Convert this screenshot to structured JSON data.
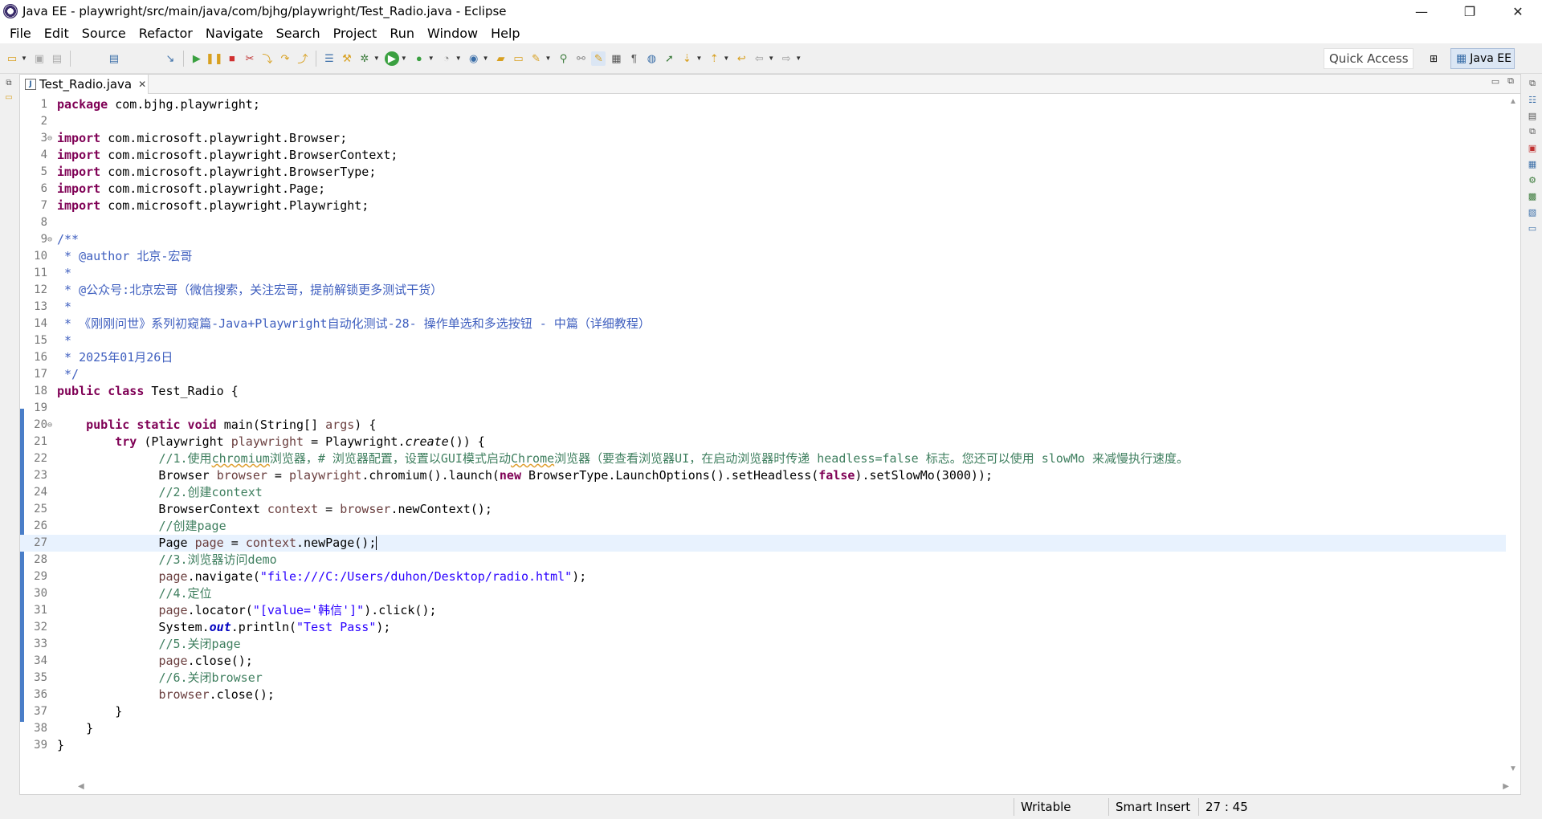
{
  "window": {
    "title": "Java EE - playwright/src/main/java/com/bjhg/playwright/Test_Radio.java - Eclipse",
    "minimize": "—",
    "restore": "❐",
    "close": "✕"
  },
  "menu": [
    "File",
    "Edit",
    "Source",
    "Refactor",
    "Navigate",
    "Search",
    "Project",
    "Run",
    "Window",
    "Help"
  ],
  "toolbar": {
    "quick_access": "Quick Access",
    "perspective": "Java EE"
  },
  "editor": {
    "tab_label": "Test_Radio.java",
    "tab_close": "✕",
    "lines": [
      {
        "n": "1",
        "html": "<span class=\"kw\">package</span> com.bjhg.playwright;"
      },
      {
        "n": "2",
        "html": ""
      },
      {
        "n": "3",
        "fold": "⊖",
        "html": "<span class=\"kw\">import</span> com.microsoft.playwright.Browser;"
      },
      {
        "n": "4",
        "html": "<span class=\"kw\">import</span> com.microsoft.playwright.BrowserContext;"
      },
      {
        "n": "5",
        "html": "<span class=\"kw\">import</span> com.microsoft.playwright.BrowserType;"
      },
      {
        "n": "6",
        "html": "<span class=\"kw\">import</span> com.microsoft.playwright.Page;"
      },
      {
        "n": "7",
        "html": "<span class=\"kw\">import</span> com.microsoft.playwright.Playwright;"
      },
      {
        "n": "8",
        "html": ""
      },
      {
        "n": "9",
        "fold": "⊖",
        "html": "<span class=\"jd\">/**</span>"
      },
      {
        "n": "10",
        "html": "<span class=\"jd\"> * @author 北京-宏哥</span>"
      },
      {
        "n": "11",
        "html": "<span class=\"jd\"> *</span>"
      },
      {
        "n": "12",
        "html": "<span class=\"jd\"> * @公众号:北京宏哥（微信搜索，关注宏哥，提前解锁更多测试干货）</span>"
      },
      {
        "n": "13",
        "html": "<span class=\"jd\"> *</span>"
      },
      {
        "n": "14",
        "html": "<span class=\"jd\"> * 《刚刚问世》系列初窥篇-Java+Playwright自动化测试-28- 操作单选和多选按钮 - 中篇（详细教程）</span>"
      },
      {
        "n": "15",
        "html": "<span class=\"jd\"> *</span>"
      },
      {
        "n": "16",
        "html": "<span class=\"jd\"> * 2025年01月26日</span>"
      },
      {
        "n": "17",
        "html": "<span class=\"jd\"> */</span>"
      },
      {
        "n": "18",
        "html": "<span class=\"kw\">public class</span> Test_Radio {"
      },
      {
        "n": "19",
        "html": ""
      },
      {
        "n": "20",
        "fold": "⊖",
        "html": "    <span class=\"kw\">public static void</span> main(String[] <span class=\"vr\">args</span>) {"
      },
      {
        "n": "21",
        "html": "        <span class=\"kw\">try</span> (Playwright <span class=\"vr\">playwright</span> = Playwright.<span class=\"it\">create</span>()) {"
      },
      {
        "n": "22",
        "html": "              <span class=\"cm\">//1.使用<span class=\"sq\">chromium</span>浏览器，# 浏览器配置，设置以GUI模式启动<span class=\"sq\">Chrome</span>浏览器（要查看浏览器UI，在启动浏览器时传递 headless=false 标志。您还可以使用 slowMo 来减慢执行速度。</span>"
      },
      {
        "n": "23",
        "html": "              Browser <span class=\"vr\">browser</span> = <span class=\"vr\">playwright</span>.chromium().launch(<span class=\"kw\">new</span> BrowserType.LaunchOptions().setHeadless(<span class=\"kw\">false</span>).setSlowMo(3000));"
      },
      {
        "n": "24",
        "html": "              <span class=\"cm\">//2.创建context</span>"
      },
      {
        "n": "25",
        "html": "              BrowserContext <span class=\"vr\">context</span> = <span class=\"vr\">browser</span>.newContext();"
      },
      {
        "n": "26",
        "html": "              <span class=\"cm\">//创建page</span>"
      },
      {
        "n": "27",
        "current": true,
        "html": "              Page <span class=\"vr\">page</span> = <span class=\"vr\">context</span>.newPage();<span class=\"cursor\"></span>"
      },
      {
        "n": "28",
        "html": "              <span class=\"cm\">//3.浏览器访问demo</span>"
      },
      {
        "n": "29",
        "html": "              <span class=\"vr\">page</span>.navigate(<span class=\"st\">\"file:///C:/Users/duhon/Desktop/radio.html\"</span>);"
      },
      {
        "n": "30",
        "html": "              <span class=\"cm\">//4.定位</span>"
      },
      {
        "n": "31",
        "html": "              <span class=\"vr\">page</span>.locator(<span class=\"st\">\"[value='韩信']\"</span>).click();"
      },
      {
        "n": "32",
        "html": "              System.<span class=\"fld\">out</span>.println(<span class=\"st\">\"Test Pass\"</span>);"
      },
      {
        "n": "33",
        "html": "              <span class=\"cm\">//5.关闭page</span>"
      },
      {
        "n": "34",
        "html": "              <span class=\"vr\">page</span>.close();"
      },
      {
        "n": "35",
        "html": "              <span class=\"cm\">//6.关闭browser</span>"
      },
      {
        "n": "36",
        "html": "              <span class=\"vr\">browser</span>.close();"
      },
      {
        "n": "37",
        "html": "        }"
      },
      {
        "n": "38",
        "html": "    }"
      },
      {
        "n": "39",
        "html": "}"
      }
    ]
  },
  "status": {
    "writable": "Writable",
    "insert_mode": "Smart Insert",
    "position": "27 : 45"
  }
}
